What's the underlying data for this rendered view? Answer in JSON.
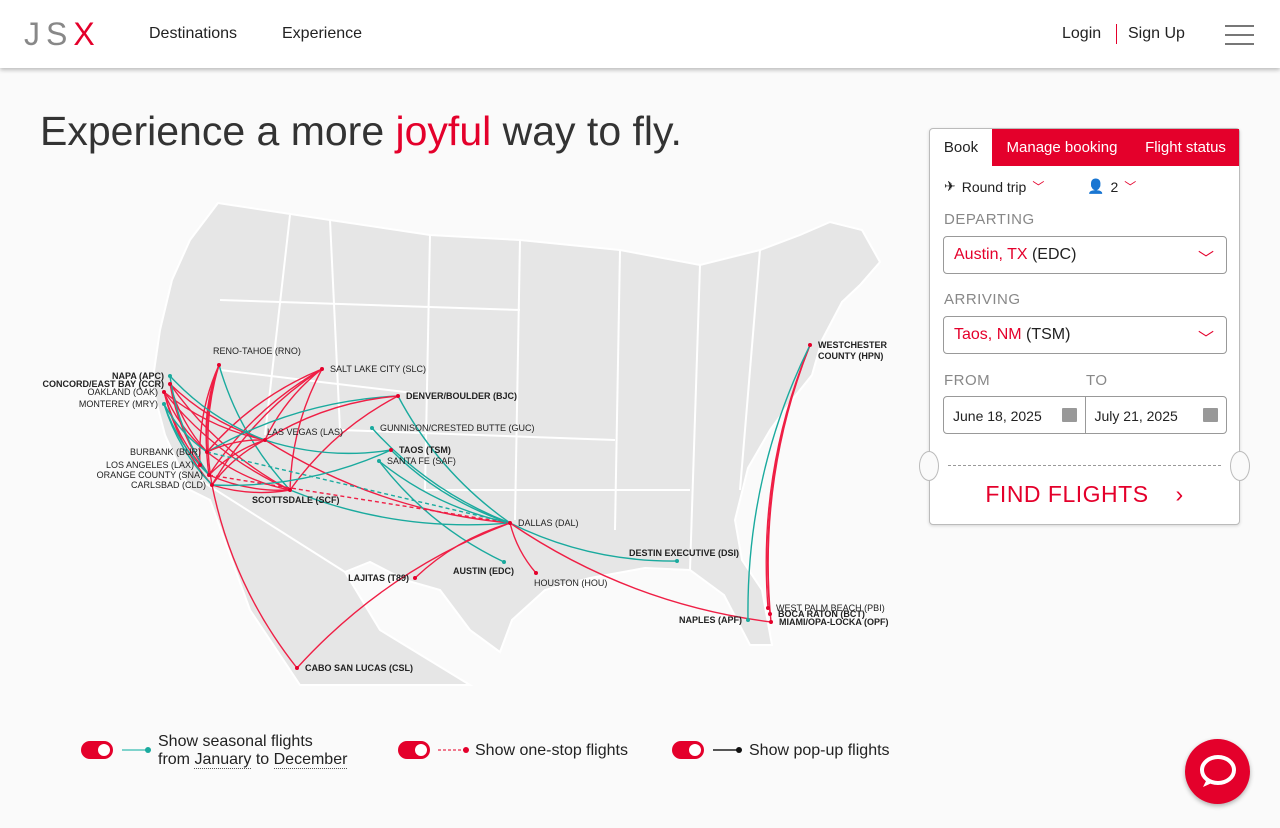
{
  "header": {
    "logo": "JSX",
    "nav": [
      "Destinations",
      "Experience"
    ],
    "login": "Login",
    "signup": "Sign Up"
  },
  "hero": {
    "pre": "Experience a more ",
    "accent": "joyful",
    "post": " way to fly."
  },
  "booking": {
    "tabs": [
      "Book",
      "Manage booking",
      "Flight status"
    ],
    "trip_type": "Round trip",
    "passengers": "2",
    "departing_label": "DEPARTING",
    "departing_city": "Austin, TX",
    "departing_code": "(EDC)",
    "arriving_label": "ARRIVING",
    "arriving_city": "Taos, NM",
    "arriving_code": "(TSM)",
    "from_label": "FROM",
    "to_label": "TO",
    "from_date": "June 18, 2025",
    "to_date": "July 21, 2025",
    "find": "FIND FLIGHTS"
  },
  "map": {
    "cities": {
      "RNO": {
        "label": "RENO-TAHOE (RNO)",
        "bold": false
      },
      "SLC": {
        "label": "SALT LAKE CITY (SLC)",
        "bold": false
      },
      "APC": {
        "label": "NAPA (APC)",
        "bold": true
      },
      "CCR": {
        "label": "CONCORD/EAST BAY (CCR)",
        "bold": true
      },
      "OAK": {
        "label": "OAKLAND (OAK)",
        "bold": false
      },
      "MRY": {
        "label": "MONTEREY (MRY)",
        "bold": false
      },
      "BJC": {
        "label": "DENVER/BOULDER (BJC)",
        "bold": true
      },
      "GUC": {
        "label": "GUNNISON/CRESTED BUTTE (GUC)",
        "bold": false
      },
      "LAS": {
        "label": "LAS VEGAS (LAS)",
        "bold": false
      },
      "TSM": {
        "label": "TAOS (TSM)",
        "bold": true
      },
      "SAF": {
        "label": "SANTA FE (SAF)",
        "bold": false
      },
      "BUR": {
        "label": "BURBANK (BUR)",
        "bold": false
      },
      "LAX": {
        "label": "LOS ANGELES (LAX)",
        "bold": false
      },
      "SNA": {
        "label": "ORANGE COUNTY (SNA)",
        "bold": false
      },
      "CLD": {
        "label": "CARLSBAD (CLD)",
        "bold": false
      },
      "SCF": {
        "label": "SCOTTSDALE (SCF)",
        "bold": true
      },
      "DAL": {
        "label": "DALLAS (DAL)",
        "bold": false
      },
      "DSI": {
        "label": "DESTIN EXECUTIVE (DSI)",
        "bold": true
      },
      "T89": {
        "label": "LAJITAS (T89)",
        "bold": true
      },
      "EDC": {
        "label": "AUSTIN (EDC)",
        "bold": true
      },
      "HOU": {
        "label": "HOUSTON (HOU)",
        "bold": false
      },
      "CSL": {
        "label": "CABO SAN LUCAS (CSL)",
        "bold": true
      },
      "HPN": {
        "label": "WESTCHESTER",
        "label2": "COUNTY (HPN)",
        "bold": true
      },
      "PBI": {
        "label": "WEST PALM BEACH (PBI)",
        "bold": false
      },
      "BCT": {
        "label": "BOCA RATON (BCT)",
        "bold": true
      },
      "OPF": {
        "label": "MIAMI/OPA-LOCKA (OPF)",
        "bold": true
      },
      "APF": {
        "label": "NAPLES (APF)",
        "bold": true
      }
    },
    "routes": [
      [
        "RNO",
        "BUR",
        "r"
      ],
      [
        "RNO",
        "SNA",
        "r"
      ],
      [
        "RNO",
        "CLD",
        "r"
      ],
      [
        "RNO",
        "LAX",
        "r"
      ],
      [
        "RNO",
        "SCF",
        "t"
      ],
      [
        "SLC",
        "BUR",
        "r"
      ],
      [
        "SLC",
        "SNA",
        "r"
      ],
      [
        "SLC",
        "LAS",
        "r"
      ],
      [
        "SLC",
        "SCF",
        "r"
      ],
      [
        "SLC",
        "CLD",
        "r"
      ],
      [
        "OAK",
        "BUR",
        "r"
      ],
      [
        "OAK",
        "SNA",
        "r"
      ],
      [
        "OAK",
        "LAS",
        "r"
      ],
      [
        "OAK",
        "SCF",
        "r"
      ],
      [
        "OAK",
        "CLD",
        "r"
      ],
      [
        "CCR",
        "BUR",
        "r"
      ],
      [
        "CCR",
        "SNA",
        "r"
      ],
      [
        "CCR",
        "LAS",
        "r"
      ],
      [
        "CCR",
        "SCF",
        "r"
      ],
      [
        "APC",
        "SNA",
        "t"
      ],
      [
        "APC",
        "LAS",
        "t"
      ],
      [
        "MRY",
        "BUR",
        "t"
      ],
      [
        "MRY",
        "SNA",
        "t"
      ],
      [
        "MRY",
        "CLD",
        "t"
      ],
      [
        "BJC",
        "BUR",
        "t"
      ],
      [
        "BJC",
        "SCF",
        "r"
      ],
      [
        "BJC",
        "LAS",
        "r"
      ],
      [
        "BJC",
        "DAL",
        "t"
      ],
      [
        "LAS",
        "BUR",
        "r"
      ],
      [
        "LAS",
        "SNA",
        "r"
      ],
      [
        "LAS",
        "CLD",
        "r"
      ],
      [
        "LAS",
        "DAL",
        "r"
      ],
      [
        "LAS",
        "TSM",
        "t"
      ],
      [
        "SNA",
        "SCF",
        "r"
      ],
      [
        "CLD",
        "SCF",
        "r"
      ],
      [
        "BUR",
        "SCF",
        "r"
      ],
      [
        "CLD",
        "TSM",
        "t"
      ],
      [
        "SCF",
        "DAL",
        "t"
      ],
      [
        "GUC",
        "DAL",
        "t"
      ],
      [
        "TSM",
        "DAL",
        "t"
      ],
      [
        "SAF",
        "EDC",
        "t"
      ],
      [
        "SAF",
        "DAL",
        "t"
      ],
      [
        "DAL",
        "T89",
        "r"
      ],
      [
        "DAL",
        "CSL",
        "r"
      ],
      [
        "DAL",
        "HOU",
        "r"
      ],
      [
        "DAL",
        "DSI",
        "t"
      ],
      [
        "DAL",
        "OPF",
        "r"
      ],
      [
        "CLD",
        "CSL",
        "r"
      ],
      [
        "HPN",
        "PBI",
        "r"
      ],
      [
        "HPN",
        "BCT",
        "r"
      ],
      [
        "HPN",
        "OPF",
        "r"
      ],
      [
        "HPN",
        "APF",
        "t"
      ],
      [
        "SNA",
        "DAL",
        "o"
      ],
      [
        "BUR",
        "DAL",
        "s"
      ]
    ]
  },
  "legend": {
    "seasonal_line1": "Show seasonal flights",
    "seasonal_from": "from ",
    "seasonal_start": "January",
    "seasonal_to": " to ",
    "seasonal_end": "December",
    "onestop": "Show one-stop flights",
    "popup": "Show pop-up flights"
  },
  "colors": {
    "brand": "#e4002b",
    "teal": "#1aaa9e",
    "land": "#e6e6e6"
  }
}
